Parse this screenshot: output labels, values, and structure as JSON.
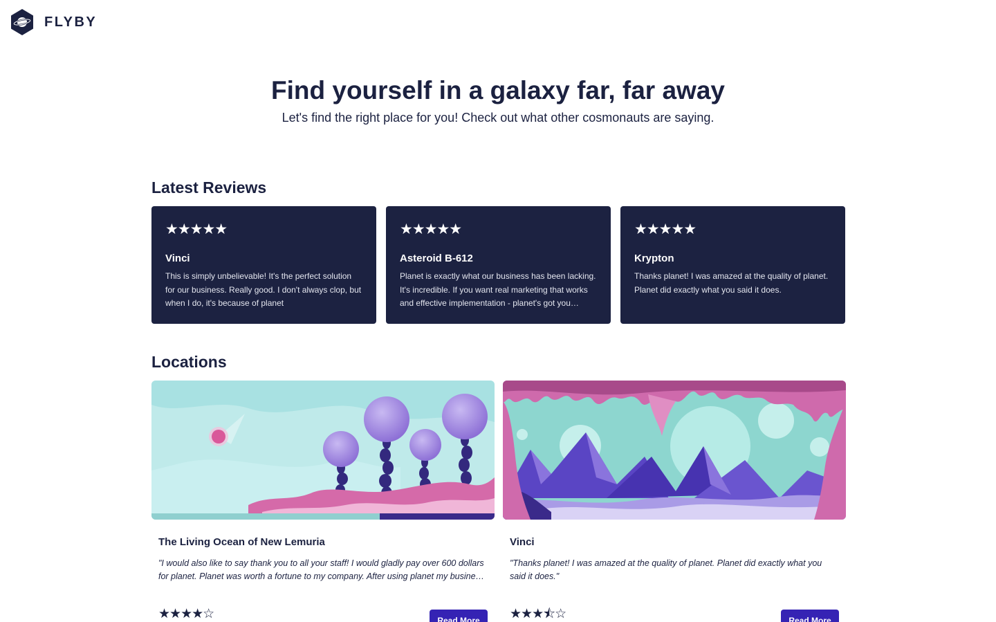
{
  "brand": {
    "name": "FLYBY",
    "logo_icon": "planet-hexagon-icon",
    "logo_color": "#1c2241"
  },
  "hero": {
    "title": "Find yourself in a galaxy far, far away",
    "subtitle": "Let's find the right place for you! Check out what other cosmonauts are saying."
  },
  "reviews": {
    "heading": "Latest Reviews",
    "items": [
      {
        "stars": "★★★★★",
        "rating": 5,
        "name": "Vinci",
        "text": "This is simply unbelievable! It's the perfect solution for our business. Really good. I don't always clop, but when I do, it's because of planet"
      },
      {
        "stars": "★★★★★",
        "rating": 5,
        "name": "Asteroid B-612",
        "text": "Planet is exactly what our business has been lacking. It's incredible. If you want real marketing that works and effective implementation - planet's got you covered."
      },
      {
        "stars": "★★★★★",
        "rating": 5,
        "name": "Krypton",
        "text": "Thanks planet! I was amazed at the quality of planet. Planet did exactly what you said it does."
      }
    ]
  },
  "locations": {
    "heading": "Locations",
    "items": [
      {
        "title": "The Living Ocean of New Lemuria",
        "quote": "\"I would also like to say thank you to all your staff! I would gladly pay over 600 dollars for planet. Planet was worth a fortune to my company. After using planet my business skyrocketed!\"",
        "rating": 4,
        "stars": "★★★★☆",
        "button": "Read More"
      },
      {
        "title": "Vinci",
        "quote": "\"Thanks planet! I was amazed at the quality of planet. Planet did exactly what you said it does.\"",
        "rating": 3.5,
        "stars": "★★★⯪☆",
        "button": "Read More"
      }
    ]
  },
  "colors": {
    "card_bg": "#1c2241",
    "button_bg": "#3523b4",
    "text": "#1b2140"
  }
}
